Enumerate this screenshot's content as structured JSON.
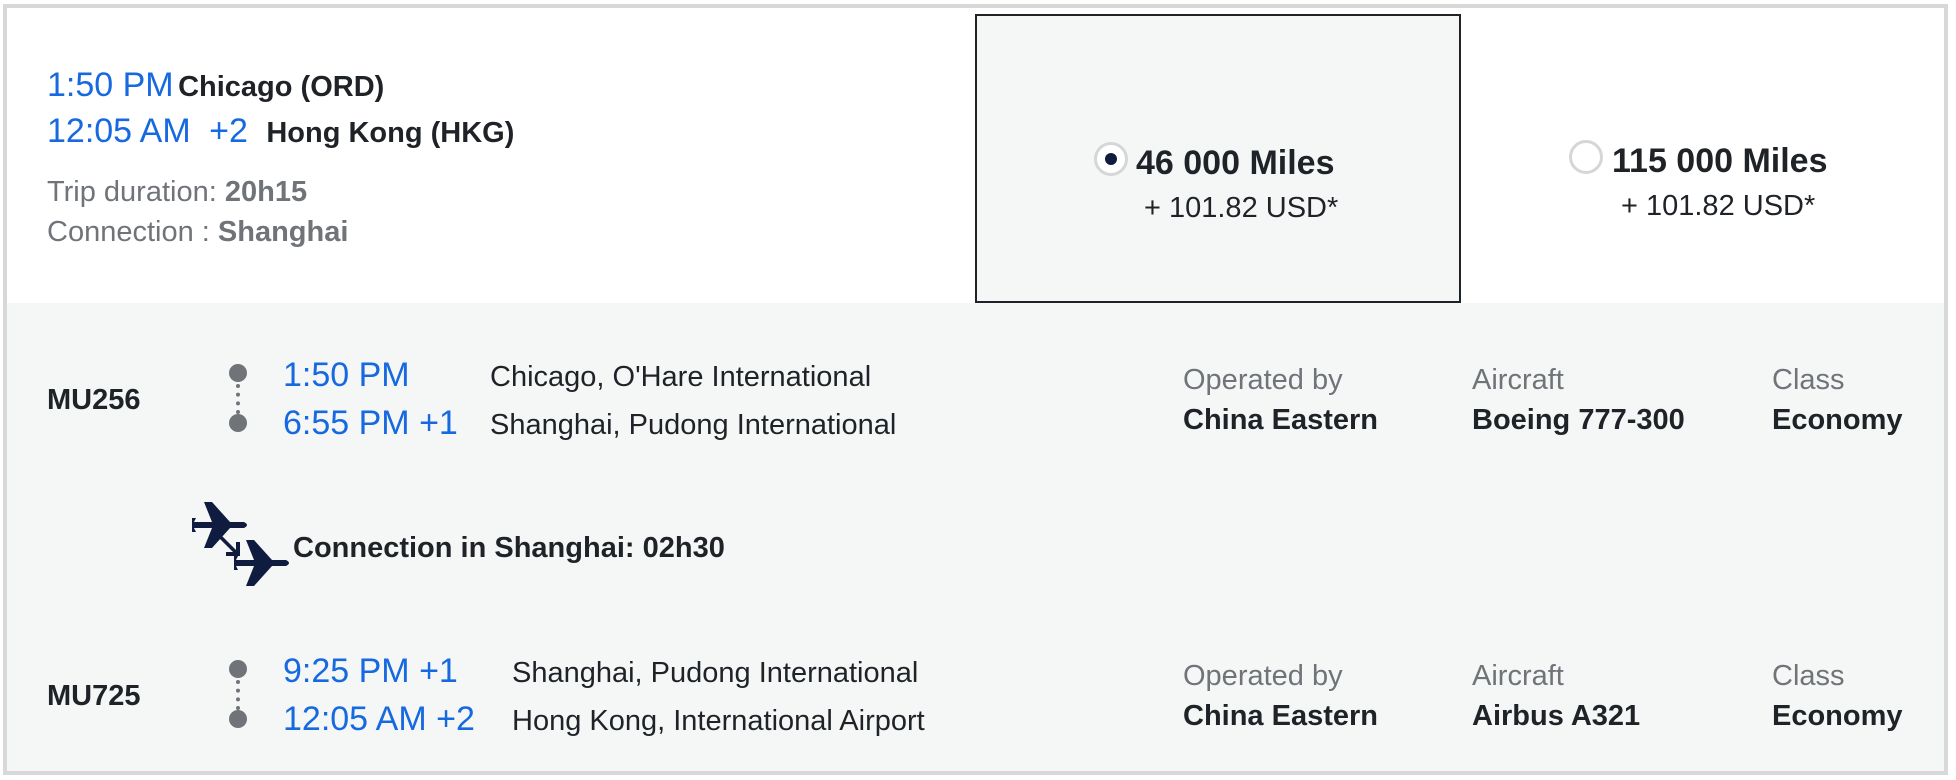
{
  "summary": {
    "depart_time": "1:50 PM",
    "depart_city": "Chicago (ORD)",
    "arrive_time": "12:05 AM",
    "arrive_day_offset": "+2",
    "arrive_city": "Hong Kong (HKG)",
    "trip_duration_label": "Trip duration:",
    "trip_duration_value": "20h15",
    "connection_label": "Connection :",
    "connection_value": "Shanghai"
  },
  "fares": [
    {
      "miles": "46 000 Miles",
      "cash": "+ 101.82 USD*",
      "selected": true
    },
    {
      "miles": "115 000 Miles",
      "cash": "+ 101.82 USD*",
      "selected": false
    }
  ],
  "segments": [
    {
      "flight_number": "MU256",
      "depart_time": "1:50 PM",
      "depart_place": "Chicago, O'Hare International",
      "arrive_time": "6:55 PM +1",
      "arrive_place": "Shanghai, Pudong International",
      "operated_by_label": "Operated by",
      "operated_by": "China Eastern",
      "aircraft_label": "Aircraft",
      "aircraft": "Boeing 777-300",
      "class_label": "Class",
      "class": "Economy"
    },
    {
      "flight_number": "MU725",
      "depart_time": "9:25 PM +1",
      "depart_place": "Shanghai, Pudong International",
      "arrive_time": "12:05 AM +2",
      "arrive_place": "Hong Kong, International Airport",
      "operated_by_label": "Operated by",
      "operated_by": "China Eastern",
      "aircraft_label": "Aircraft",
      "aircraft": "Airbus A321",
      "class_label": "Class",
      "class": "Economy"
    }
  ],
  "connection": {
    "text": "Connection in Shanghai: 02h30",
    "icon": "connecting-flights-icon"
  },
  "colors": {
    "accent_blue": "#1769e0",
    "text_dark": "#1f2327",
    "text_gray": "#707478",
    "panel_bg": "#f5f7f7",
    "radio_selected": "#0f1c3f"
  }
}
